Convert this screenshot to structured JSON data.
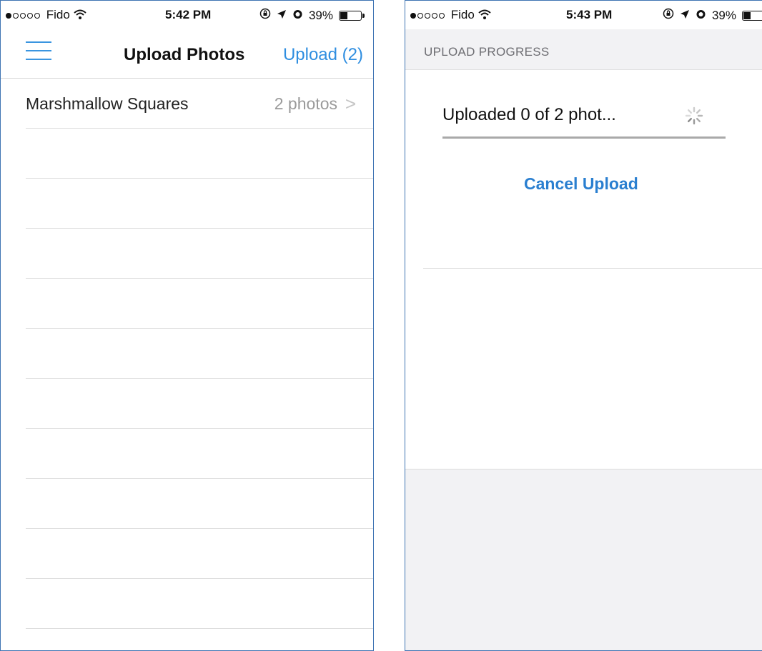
{
  "left_screen": {
    "status": {
      "carrier": "Fido",
      "time": "5:42 PM",
      "battery": "39%",
      "signal_strength": 1,
      "battery_level": 0.39
    },
    "nav": {
      "menu_icon": "hamburger-menu-icon",
      "title": "Upload Photos",
      "upload_label": "Upload (2)"
    },
    "list": [
      {
        "label": "Marshmallow Squares",
        "count": "2 photos",
        "chevron": ">"
      }
    ],
    "empty_rows": 10
  },
  "right_screen": {
    "status": {
      "carrier": "Fido",
      "time": "5:43 PM",
      "battery": "39%",
      "signal_strength": 1,
      "battery_level": 0.39
    },
    "section_header": "UPLOAD PROGRESS",
    "progress_text": "Uploaded 0 of 2 phot...",
    "progress": 0,
    "cancel_label": "Cancel Upload"
  },
  "colors": {
    "accent": "#2f8ee0",
    "frame": "#3f74b3"
  }
}
